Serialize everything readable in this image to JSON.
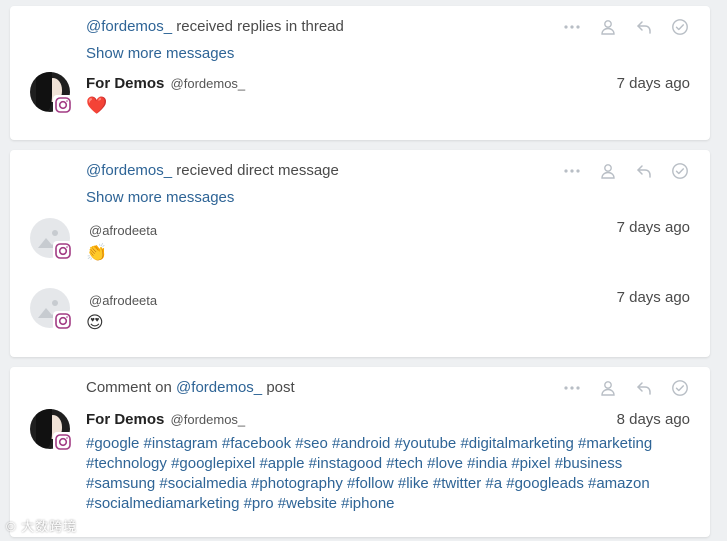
{
  "cards": [
    {
      "header_prefix": "",
      "header_mention": "@fordemos_",
      "header_suffix": " received replies in thread",
      "show_more": "Show more messages",
      "messages": [
        {
          "display_name": "For Demos",
          "handle": "@fordemos_",
          "time": "7 days ago",
          "body": "❤️"
        }
      ]
    },
    {
      "header_prefix": "",
      "header_mention": "@fordemos_",
      "header_suffix": " recieved direct message",
      "show_more": "Show more messages",
      "messages": [
        {
          "handle": "@afrodeeta",
          "time": "7 days ago",
          "body": "👏"
        },
        {
          "handle": "@afrodeeta",
          "time": "7 days ago",
          "body": "😍"
        }
      ]
    },
    {
      "header_prefix": "Comment on ",
      "header_mention": "@fordemos_",
      "header_suffix": " post",
      "messages": [
        {
          "display_name": "For Demos",
          "handle": "@fordemos_",
          "time": "8 days ago",
          "hashtag_lines": [
            "#google #instagram #facebook #seo #android #youtube #digitalmarketing #marketing",
            "#technology #googlepixel #apple #instagood #tech #love #india #pixel #business",
            "#samsung #socialmedia #photography #follow #like #twitter #a #googleads #amazon",
            "#socialmediamarketing #pro #website #iphone"
          ]
        }
      ]
    }
  ],
  "actions": [
    "more-icon",
    "assign-user-icon",
    "reply-icon",
    "resolve-check-icon"
  ],
  "icons": {
    "platform_badge": "instagram-icon"
  },
  "colors": {
    "link": "#2e6496",
    "muted_icon": "#b8bec5",
    "background": "#eef0f2"
  },
  "watermark": "© 大数跨境"
}
